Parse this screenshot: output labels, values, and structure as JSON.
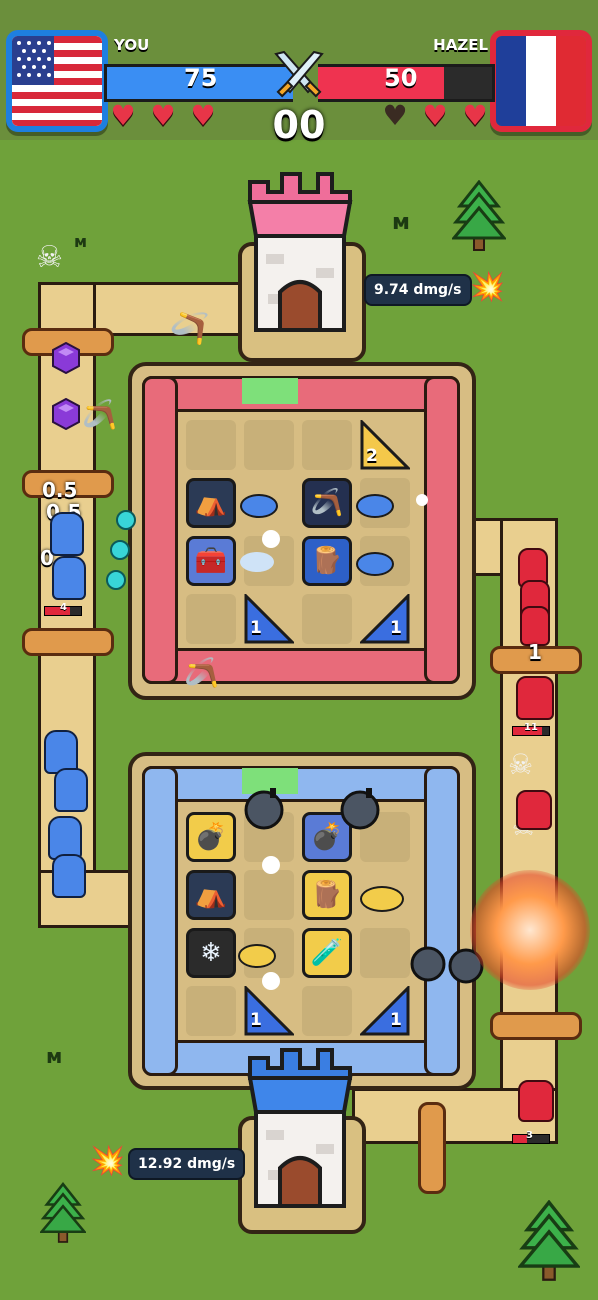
{
  "hud": {
    "player_name": "YOU",
    "opponent_name": "HAZEL",
    "player_score": "75",
    "opponent_score": "50",
    "timer": "00",
    "player_hp_fraction": 1.0,
    "opponent_hp_fraction": 0.72,
    "player_hearts": [
      true,
      true,
      true
    ],
    "opponent_hearts": [
      false,
      true,
      true
    ],
    "player_flag": "flag-usa-icon",
    "opponent_flag": "flag-france-icon"
  },
  "stats": {
    "enemy_dps": "9.74 dmg/s",
    "player_dps": "12.92 dmg/s"
  },
  "red_board": {
    "triangles": [
      "2",
      "1",
      "1"
    ]
  },
  "blue_board": {
    "triangles": [
      "1",
      "1"
    ]
  },
  "units": {
    "blue_lane_numbers": [
      "0.5",
      "0.5",
      "0.5"
    ],
    "blue_lane_hp": "4",
    "red_lane_top_number": "1",
    "red_unit_hp_1": "11",
    "red_unit_hp_2": "3"
  },
  "colors": {
    "player": "#3a8ef3",
    "opponent": "#ef3350",
    "grass": "#6fa23a",
    "path": "#e9cf8f"
  }
}
